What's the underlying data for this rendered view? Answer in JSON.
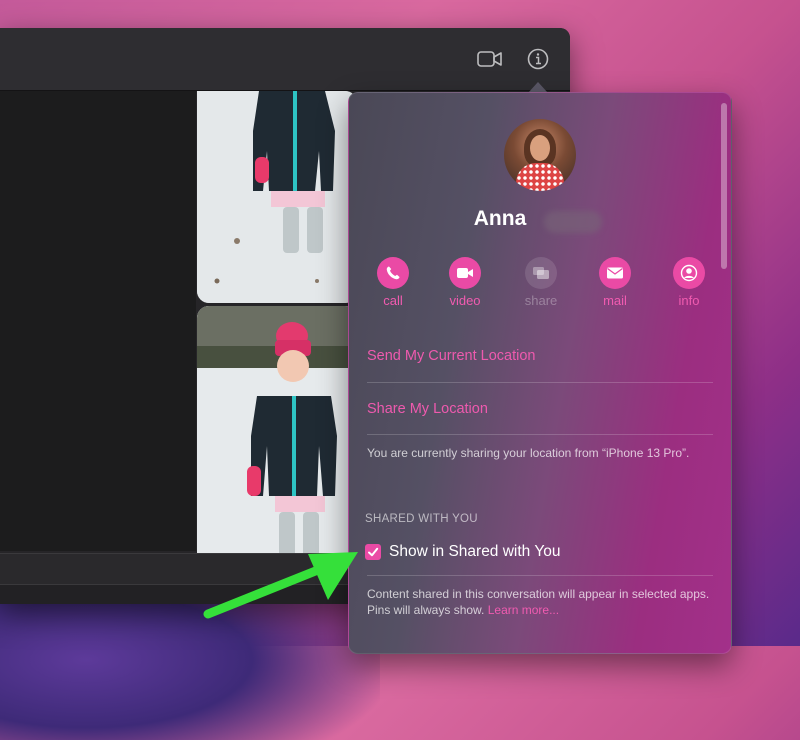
{
  "toolbar": {
    "video_icon": "video-camera-icon",
    "info_icon": "info-icon"
  },
  "contact": {
    "name": "Anna"
  },
  "actions": [
    {
      "label": "call",
      "icon": "phone-icon",
      "enabled": true
    },
    {
      "label": "video",
      "icon": "video-camera-icon",
      "enabled": true
    },
    {
      "label": "share",
      "icon": "share-screen-icon",
      "enabled": false
    },
    {
      "label": "mail",
      "icon": "envelope-icon",
      "enabled": true
    },
    {
      "label": "info",
      "icon": "person-icon",
      "enabled": true
    }
  ],
  "location": {
    "send_current": "Send My Current Location",
    "share": "Share My Location",
    "note": "You are currently sharing your location from “iPhone 13 Pro”."
  },
  "shared_with_you": {
    "header": "SHARED WITH YOU",
    "checkbox_label": "Show in Shared with You",
    "checked": true,
    "note": "Content shared in this conversation will appear in selected apps. Pins will always show.",
    "learn_more": "Learn more..."
  },
  "colors": {
    "accent": "#ea4aa5",
    "annotation_arrow": "#35e03a"
  }
}
